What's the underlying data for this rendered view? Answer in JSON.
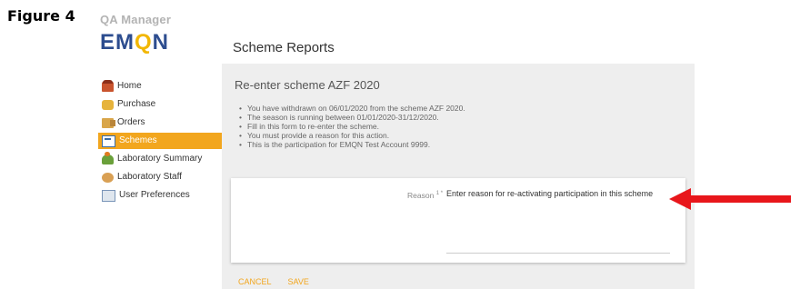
{
  "figure_label": "Figure 4",
  "app": {
    "product_title": "QA Manager",
    "logo": {
      "part1": "EM",
      "part2": "Q",
      "part3": "N"
    },
    "page_heading": "Scheme Reports"
  },
  "sidebar": {
    "items": [
      {
        "label": "Home",
        "icon": "home-icon"
      },
      {
        "label": "Purchase",
        "icon": "purchase-icon"
      },
      {
        "label": "Orders",
        "icon": "orders-icon"
      },
      {
        "label": "Schemes",
        "icon": "schemes-icon",
        "active": true
      },
      {
        "label": "Laboratory Summary",
        "icon": "laboratory-summary-icon"
      },
      {
        "label": "Laboratory Staff",
        "icon": "laboratory-staff-icon"
      },
      {
        "label": "User Preferences",
        "icon": "user-preferences-icon"
      }
    ]
  },
  "main": {
    "title": "Re-enter scheme AZF 2020",
    "info": [
      "You have withdrawn on 06/01/2020 from the scheme AZF 2020.",
      "The season is running between 01/01/2020-31/12/2020.",
      "Fill in this form to re-enter the scheme.",
      "You must provide a reason for this action.",
      "This is the participation for EMQN Test Account 9999."
    ],
    "form": {
      "reason_label": "Reason",
      "required_marker": "1 *",
      "reason_placeholder": "Enter reason for re-activating participation in this scheme"
    },
    "actions": {
      "cancel": "CANCEL",
      "save": "SAVE"
    }
  },
  "annotation": {
    "arrow_color": "#e8161b"
  },
  "colors": {
    "accent": "#f2a61e",
    "logo_blue": "#2d4d8f",
    "logo_yellow": "#f2b705"
  }
}
